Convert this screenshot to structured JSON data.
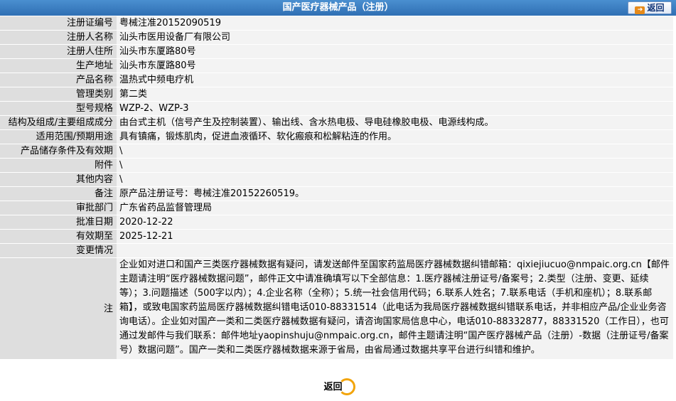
{
  "header": {
    "title": "国产医疗器械产品（注册）",
    "back_label": "返回"
  },
  "rows": [
    {
      "label": "注册证编号",
      "value": "粤械注准20152090519"
    },
    {
      "label": "注册人名称",
      "value": "汕头市医用设备厂有限公司"
    },
    {
      "label": "注册人住所",
      "value": "汕头市东厦路80号"
    },
    {
      "label": "生产地址",
      "value": "汕头市东厦路80号"
    },
    {
      "label": "产品名称",
      "value": "温热式中频电疗机"
    },
    {
      "label": "管理类别",
      "value": "第二类"
    },
    {
      "label": "型号规格",
      "value": "WZP-2、WZP-3"
    },
    {
      "label": "结构及组成/主要组成成分",
      "value": "由台式主机（信号产生及控制装置）、输出线、含水热电极、导电硅橡胶电极、电源线构成。"
    },
    {
      "label": "适用范围/预期用途",
      "value": "具有镇痛，锻炼肌肉，促进血液循环、软化瘢痕和松解粘连的作用。"
    },
    {
      "label": "产品储存条件及有效期",
      "value": "\\"
    },
    {
      "label": "附件",
      "value": "\\"
    },
    {
      "label": "其他内容",
      "value": "\\"
    },
    {
      "label": "备注",
      "value": "原产品注册证号：粤械注准20152260519。"
    },
    {
      "label": "审批部门",
      "value": "广东省药品监督管理局"
    },
    {
      "label": "批准日期",
      "value": "2020-12-22"
    },
    {
      "label": "有效期至",
      "value": "2025-12-21"
    },
    {
      "label": "变更情况",
      "value": ""
    }
  ],
  "note": {
    "label": "注",
    "text": "企业如对进口和国产三类医疗器械数据有疑问，请发送邮件至国家药监局医疗器械数据纠错邮箱：qixiejiucuo@nmpaic.org.cn【邮件主题请注明“医疗器械数据问题”，邮件正文中请准确填写以下全部信息：1.医疗器械注册证号/备案号；2.类型（注册、变更、延续等）；3.问题描述（500字以内）；4.企业名称（全称）；5.统一社会信用代码；6.联系人姓名；7.联系电话（手机和座机）；8.联系邮箱】，或致电国家药监局医疗器械数据纠错电话010-88331514（此电话为我局医疗器械数据纠错联系电话，并非相应产品/企业业务咨询电话）。企业如对国产一类和二类医疗器械数据有疑问，请咨询国家局信息中心，电话010-88332877，88331520（工作日），也可通过发邮件与我们联系：邮件地址yaopinshuju@nmpaic.org.cn，邮件主题请注明“国产医疗器械产品（注册）-数据（注册证号/备案号）数据问题”。国产一类和二类医疗器械数据来源于省局，由省局通过数据共享平台进行纠错和维护。"
  },
  "footer": {
    "back_label": "返回"
  }
}
